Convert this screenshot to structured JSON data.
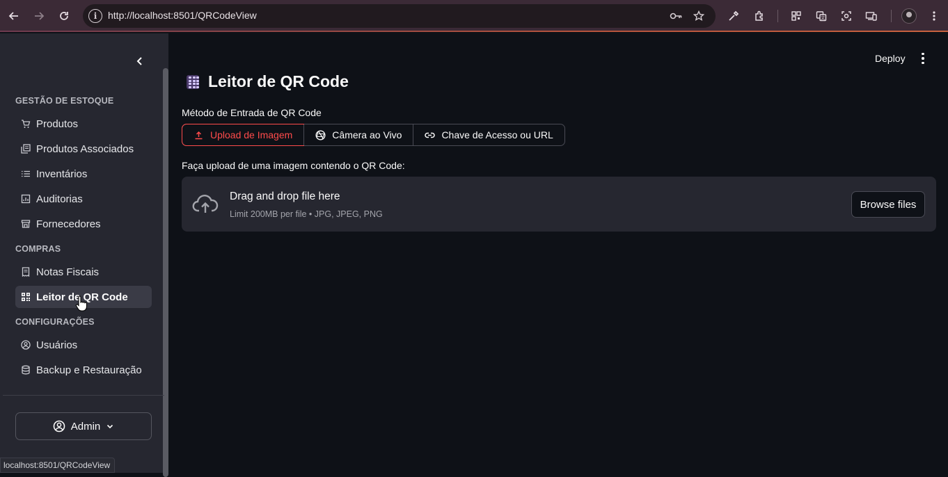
{
  "browser": {
    "url": "http://localhost:8501/QRCodeView",
    "status_url": "localhost:8501/QRCodeView"
  },
  "sidebar": {
    "sections": [
      {
        "title": "GESTÃO DE ESTOQUE",
        "items": [
          {
            "label": "Produtos",
            "icon": "cart-icon"
          },
          {
            "label": "Produtos Associados",
            "icon": "library-icon"
          },
          {
            "label": "Inventários",
            "icon": "list-icon"
          },
          {
            "label": "Auditorias",
            "icon": "audit-icon"
          },
          {
            "label": "Fornecedores",
            "icon": "store-icon"
          }
        ]
      },
      {
        "title": "COMPRAS",
        "items": [
          {
            "label": "Notas Fiscais",
            "icon": "receipt-icon"
          },
          {
            "label": "Leitor de QR Code",
            "icon": "qr-code-icon",
            "active": true
          }
        ]
      },
      {
        "title": "CONFIGURAÇÕES",
        "items": [
          {
            "label": "Usuários",
            "icon": "account-circle-icon"
          },
          {
            "label": "Backup e Restauração",
            "icon": "database-icon"
          }
        ]
      }
    ],
    "user_button": "Admin"
  },
  "header": {
    "deploy_label": "Deploy"
  },
  "main": {
    "title": "Leitor de QR Code",
    "method_label": "Método de Entrada de QR Code",
    "options": [
      {
        "label": "Upload de Imagem",
        "icon": "upload-icon",
        "selected": true
      },
      {
        "label": "Câmera ao Vivo",
        "icon": "camera-shutter-icon",
        "selected": false
      },
      {
        "label": "Chave de Acesso ou URL",
        "icon": "link-icon",
        "selected": false
      }
    ],
    "upload_label": "Faça upload de uma imagem contendo o QR Code:",
    "dropzone": {
      "title": "Drag and drop file here",
      "subtitle": "Limit 200MB per file • JPG, JPEG, PNG",
      "button": "Browse files"
    }
  },
  "colors": {
    "accent": "#ff4b4b",
    "background": "#0e1117",
    "sidebar": "#262730"
  }
}
